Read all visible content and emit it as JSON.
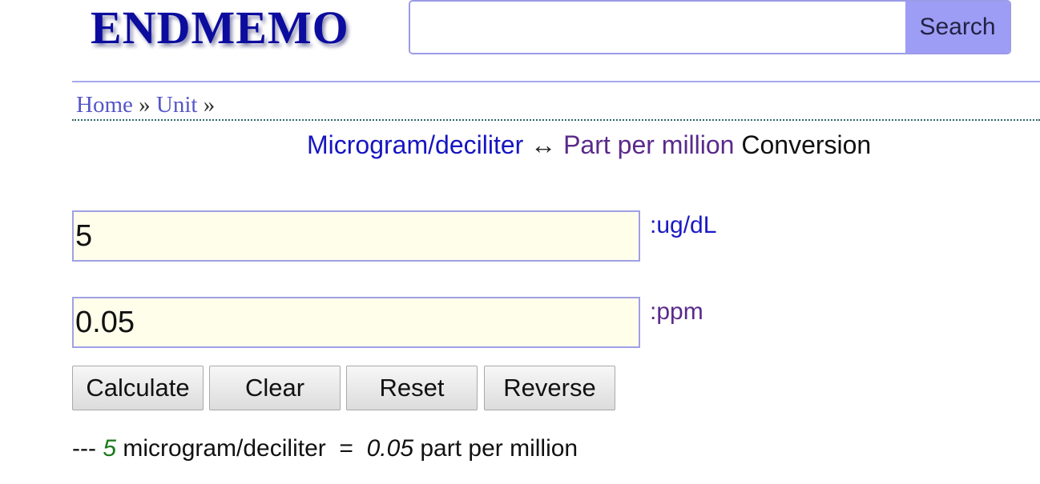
{
  "header": {
    "logo_text": "ENDMEMO",
    "search": {
      "value": "",
      "placeholder": "",
      "button_label": "Search"
    }
  },
  "breadcrumb": {
    "items": [
      {
        "label": "Home"
      },
      {
        "label": "Unit"
      }
    ],
    "separator": "»"
  },
  "title": {
    "from_unit": "Microgram/deciliter",
    "arrow": "↔",
    "to_unit": "Part per million",
    "suffix": "Conversion"
  },
  "converter": {
    "input1": {
      "value": "5",
      "unit_label": ":ug/dL"
    },
    "input2": {
      "value": "0.05",
      "unit_label": ":ppm"
    },
    "buttons": {
      "calculate": "Calculate",
      "clear": "Clear",
      "reset": "Reset",
      "reverse": "Reverse"
    }
  },
  "result": {
    "prefix": "---",
    "input_value": "5",
    "input_unit": "microgram/deciliter",
    "equals": "=",
    "output_value": "0.05",
    "output_unit": "part per million"
  },
  "colors": {
    "brand": "#0c0c9e",
    "accent_border": "#a0a0e6",
    "search_button_bg": "#9d9df6",
    "input_bg": "#fefeeb",
    "from_unit_color": "#1616c0",
    "to_unit_color": "#5a2a8a",
    "result_value_color": "#1a7a1a"
  }
}
